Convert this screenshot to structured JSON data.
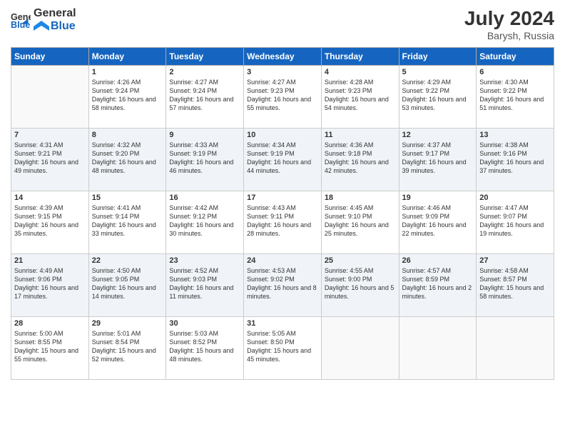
{
  "header": {
    "logo_general": "General",
    "logo_blue": "Blue",
    "month_year": "July 2024",
    "location": "Barysh, Russia"
  },
  "weekdays": [
    "Sunday",
    "Monday",
    "Tuesday",
    "Wednesday",
    "Thursday",
    "Friday",
    "Saturday"
  ],
  "weeks": [
    [
      {
        "day": "",
        "empty": true
      },
      {
        "day": "1",
        "sunrise": "4:26 AM",
        "sunset": "9:24 PM",
        "daylight": "16 hours and 58 minutes."
      },
      {
        "day": "2",
        "sunrise": "4:27 AM",
        "sunset": "9:24 PM",
        "daylight": "16 hours and 57 minutes."
      },
      {
        "day": "3",
        "sunrise": "4:27 AM",
        "sunset": "9:23 PM",
        "daylight": "16 hours and 55 minutes."
      },
      {
        "day": "4",
        "sunrise": "4:28 AM",
        "sunset": "9:23 PM",
        "daylight": "16 hours and 54 minutes."
      },
      {
        "day": "5",
        "sunrise": "4:29 AM",
        "sunset": "9:22 PM",
        "daylight": "16 hours and 53 minutes."
      },
      {
        "day": "6",
        "sunrise": "4:30 AM",
        "sunset": "9:22 PM",
        "daylight": "16 hours and 51 minutes."
      }
    ],
    [
      {
        "day": "7",
        "sunrise": "4:31 AM",
        "sunset": "9:21 PM",
        "daylight": "16 hours and 49 minutes."
      },
      {
        "day": "8",
        "sunrise": "4:32 AM",
        "sunset": "9:20 PM",
        "daylight": "16 hours and 48 minutes."
      },
      {
        "day": "9",
        "sunrise": "4:33 AM",
        "sunset": "9:19 PM",
        "daylight": "16 hours and 46 minutes."
      },
      {
        "day": "10",
        "sunrise": "4:34 AM",
        "sunset": "9:19 PM",
        "daylight": "16 hours and 44 minutes."
      },
      {
        "day": "11",
        "sunrise": "4:36 AM",
        "sunset": "9:18 PM",
        "daylight": "16 hours and 42 minutes."
      },
      {
        "day": "12",
        "sunrise": "4:37 AM",
        "sunset": "9:17 PM",
        "daylight": "16 hours and 39 minutes."
      },
      {
        "day": "13",
        "sunrise": "4:38 AM",
        "sunset": "9:16 PM",
        "daylight": "16 hours and 37 minutes."
      }
    ],
    [
      {
        "day": "14",
        "sunrise": "4:39 AM",
        "sunset": "9:15 PM",
        "daylight": "16 hours and 35 minutes."
      },
      {
        "day": "15",
        "sunrise": "4:41 AM",
        "sunset": "9:14 PM",
        "daylight": "16 hours and 33 minutes."
      },
      {
        "day": "16",
        "sunrise": "4:42 AM",
        "sunset": "9:12 PM",
        "daylight": "16 hours and 30 minutes."
      },
      {
        "day": "17",
        "sunrise": "4:43 AM",
        "sunset": "9:11 PM",
        "daylight": "16 hours and 28 minutes."
      },
      {
        "day": "18",
        "sunrise": "4:45 AM",
        "sunset": "9:10 PM",
        "daylight": "16 hours and 25 minutes."
      },
      {
        "day": "19",
        "sunrise": "4:46 AM",
        "sunset": "9:09 PM",
        "daylight": "16 hours and 22 minutes."
      },
      {
        "day": "20",
        "sunrise": "4:47 AM",
        "sunset": "9:07 PM",
        "daylight": "16 hours and 19 minutes."
      }
    ],
    [
      {
        "day": "21",
        "sunrise": "4:49 AM",
        "sunset": "9:06 PM",
        "daylight": "16 hours and 17 minutes."
      },
      {
        "day": "22",
        "sunrise": "4:50 AM",
        "sunset": "9:05 PM",
        "daylight": "16 hours and 14 minutes."
      },
      {
        "day": "23",
        "sunrise": "4:52 AM",
        "sunset": "9:03 PM",
        "daylight": "16 hours and 11 minutes."
      },
      {
        "day": "24",
        "sunrise": "4:53 AM",
        "sunset": "9:02 PM",
        "daylight": "16 hours and 8 minutes."
      },
      {
        "day": "25",
        "sunrise": "4:55 AM",
        "sunset": "9:00 PM",
        "daylight": "16 hours and 5 minutes."
      },
      {
        "day": "26",
        "sunrise": "4:57 AM",
        "sunset": "8:59 PM",
        "daylight": "16 hours and 2 minutes."
      },
      {
        "day": "27",
        "sunrise": "4:58 AM",
        "sunset": "8:57 PM",
        "daylight": "15 hours and 58 minutes."
      }
    ],
    [
      {
        "day": "28",
        "sunrise": "5:00 AM",
        "sunset": "8:55 PM",
        "daylight": "15 hours and 55 minutes."
      },
      {
        "day": "29",
        "sunrise": "5:01 AM",
        "sunset": "8:54 PM",
        "daylight": "15 hours and 52 minutes."
      },
      {
        "day": "30",
        "sunrise": "5:03 AM",
        "sunset": "8:52 PM",
        "daylight": "15 hours and 48 minutes."
      },
      {
        "day": "31",
        "sunrise": "5:05 AM",
        "sunset": "8:50 PM",
        "daylight": "15 hours and 45 minutes."
      },
      {
        "day": "",
        "empty": true
      },
      {
        "day": "",
        "empty": true
      },
      {
        "day": "",
        "empty": true
      }
    ]
  ]
}
